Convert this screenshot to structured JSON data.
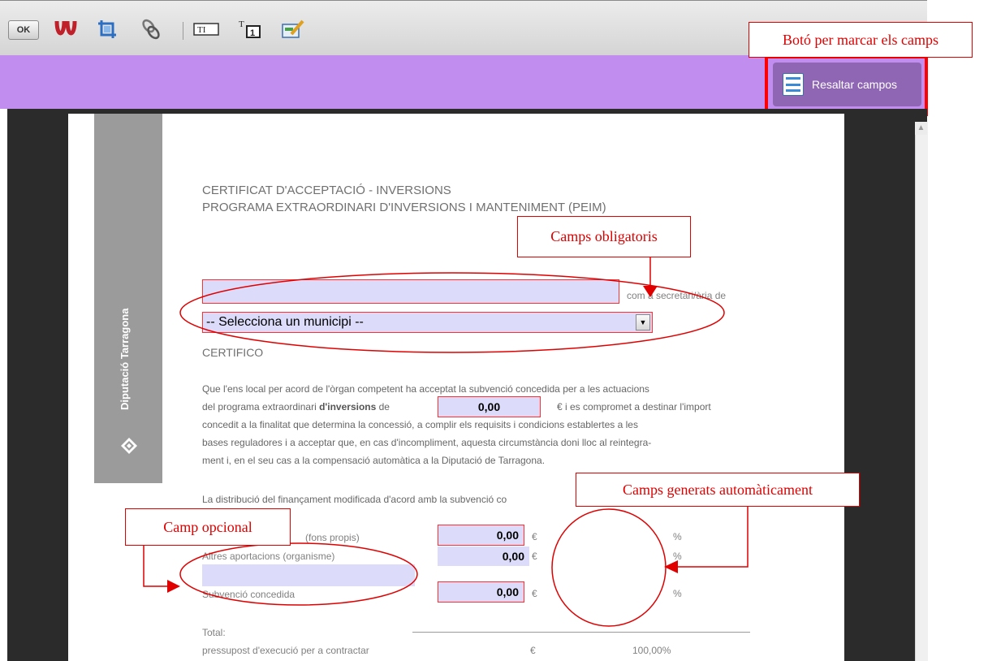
{
  "toolbar": {
    "ok_label": "OK",
    "icons": [
      "ok-button-icon",
      "acrobat-icon",
      "crop-icon",
      "link-icon",
      "text-field-icon",
      "numbered-field-icon",
      "edit-form-icon"
    ]
  },
  "highlight_button": {
    "label": "Resaltar campos",
    "icon": "highlight-fields-icon"
  },
  "document": {
    "side_band_text": "Diputació Tarragona",
    "title_line1": "CERTIFICAT D'ACCEPTACIÓ - INVERSIONS",
    "title_line2": "PROGRAMA EXTRAORDINARI D'INVERSIONS I MANTENIMENT (PEIM)",
    "name_field_value": "",
    "as_secretary": "com a secretari/ària de",
    "municipality_select": "-- Selecciona un municipi --",
    "certifico": "CERTIFICO",
    "para1_a": "Que l'ens local per acord de l'òrgan competent ha acceptat la subvenció concedida per a les actuacions",
    "para1_b_pre": "del programa extraordinari ",
    "para1_b_bold": "d'inversions",
    "para1_b_post": " de",
    "amount_value": "0,00",
    "para1_b_tail": "€  i es compromet a destinar l'import",
    "para1_c": "concedit a la finalitat que determina la concessió, a complir els requisits i condicions establertes a les",
    "para1_d": "bases reguladores i a acceptar que, en cas d'incompliment, aquesta circumstància doni lloc al reintegra-",
    "para1_e": "ment i, en el seu cas a la compensació automàtica a la Diputació de Tarragona.",
    "distribution_text": "La distribució del finançament modificada d'acord amb la subvenció co",
    "rows": [
      {
        "label": "(fons propis)",
        "value": "0,00",
        "currency": "€",
        "pct": "%"
      },
      {
        "label": "Altres aportacions (organisme)",
        "value": "0,00",
        "currency": "€",
        "pct": "%"
      },
      {
        "label": "Subvenció concedida",
        "value": "0,00",
        "currency": "€",
        "pct": "%"
      }
    ],
    "total_label": "Total:",
    "total_sub": "pressupost d'execució per a contractar",
    "total_currency": "€",
    "total_pct": "100,00%"
  },
  "annotations": {
    "mark_fields": "Botó per marcar els camps",
    "required_fields": "Camps obligatoris",
    "auto_fields": "Camps generats automàticament",
    "optional_field": "Camp opcional"
  },
  "colors": {
    "purple_bar": "#c18ef0",
    "button": "#8e66b3",
    "field_fill": "#dcdcfa",
    "annotation_red": "#e00000"
  }
}
